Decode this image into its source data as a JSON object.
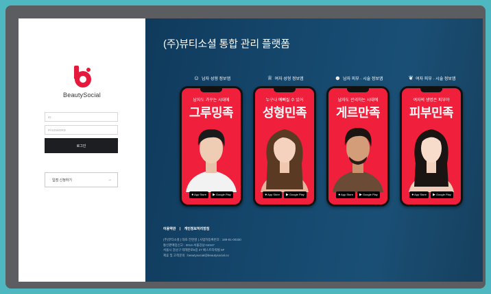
{
  "login": {
    "brand_name": "BeautySocial",
    "id_placeholder": "ID",
    "password_placeholder": "PASSWORD",
    "login_button": "로그인",
    "store_apply_button": "입점 신청하기",
    "store_apply_arrow": "→",
    "logo_letter": "b",
    "logo_color": "#e5193b"
  },
  "hero": {
    "title": "(주)뷰티소셜 통합 관리 플랫폼",
    "background": "#15476c",
    "apps": [
      {
        "label": "남자 성형 정보앱",
        "icon": "male-face-icon",
        "tagline": "남자도 가꾸는 시대에",
        "name": "그루밍족",
        "store_apple": "App Store",
        "store_google": "Google Play"
      },
      {
        "label": "여자 성형 정보앱",
        "icon": "crown-icon",
        "tagline": "누구나 예뻐질 수 있어",
        "name": "성형민족",
        "store_apple": "App Store",
        "store_google": "Google Play"
      },
      {
        "label": "남자 피부 · 시술 정보앱",
        "icon": "male-face-icon",
        "tagline": "남자도 관리하는 시대에",
        "name": "게르만족",
        "store_apple": "App Store",
        "store_google": "Google Play"
      },
      {
        "label": "여자 피부 · 시술 정보앱",
        "icon": "leaf-icon",
        "tagline": "여자의 생명은 피부야",
        "name": "피부민족",
        "store_apple": "App Store",
        "store_google": "Google Play"
      }
    ],
    "app_accent": "#f0203c"
  },
  "footer": {
    "terms": "이용약관",
    "separator": "|",
    "privacy": "개인정보처리방침",
    "lines": [
      "(주)뷰티소셜 | 대표 전현명 | 사업자등록번호 : 189-81-00330",
      "통신판매업신고 : 2014-서울강남-04347",
      "서울시 강남구 테헤란로5길 27 베스트타워빌 6F",
      "제휴 및 고객문의 : beautysocial@beautysocial.co"
    ]
  }
}
